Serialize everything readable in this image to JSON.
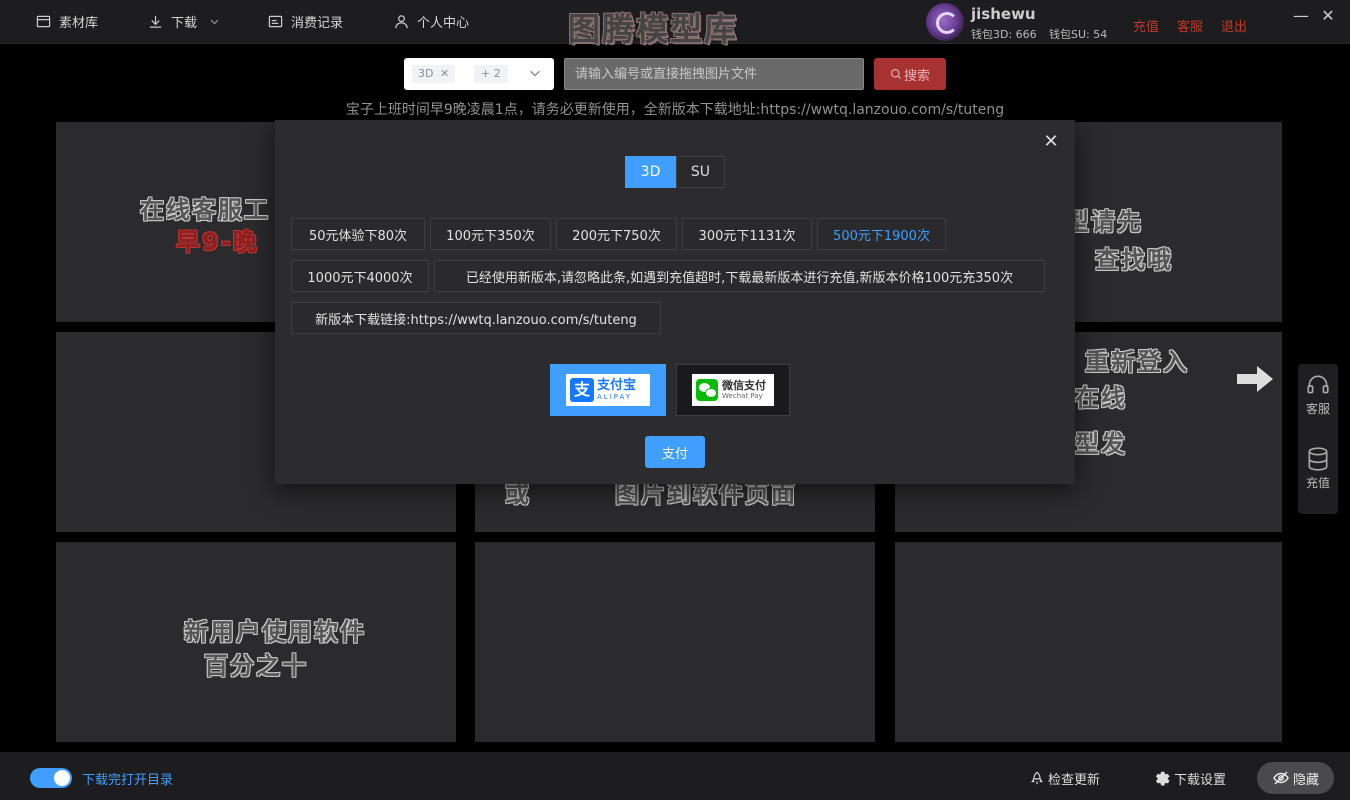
{
  "header": {
    "nav": [
      {
        "label": "素材库",
        "icon": "library-icon"
      },
      {
        "label": "下载",
        "icon": "download-icon"
      },
      {
        "label": "消费记录",
        "icon": "record-icon"
      },
      {
        "label": "个人中心",
        "icon": "user-icon"
      }
    ],
    "app_title": "图腾模型库",
    "username": "jishewu",
    "wallet_3d": "钱包3D: 666",
    "wallet_su": "钱包SU: 54",
    "links": [
      "充值",
      "客服",
      "退出"
    ]
  },
  "search": {
    "tags": [
      "3D",
      "+ 2"
    ],
    "placeholder": "请输入编号或直接拖拽图片文件",
    "button": "搜索"
  },
  "notice": "宝子上班时间早9晚凌晨1点，请务必更新使用，全新版本下载地址:https://wwtq.lanzouo.com/s/tuteng",
  "cards": [
    {
      "lines": [
        "在线客服工",
        "早9-晚"
      ]
    },
    {
      "lines": [
        "型请先",
        "查找哦"
      ]
    },
    {
      "lines": [
        "重新登入",
        "在线",
        "型发"
      ]
    },
    {
      "lines": [
        "或",
        "图片到软件页面"
      ]
    },
    {
      "lines": [
        "新用户使用软件",
        "百分之十"
      ]
    }
  ],
  "modal": {
    "tabs": [
      "3D",
      "SU"
    ],
    "active_tab": "3D",
    "packages": [
      "50元体验下80次",
      "100元下350次",
      "200元下750次",
      "300元下1131次",
      "500元下1900次",
      "1000元下4000次",
      "已经使用新版本,请忽略此条,如遇到充值超时,下载最新版本进行充值,新版本价格100元充350次",
      "新版本下载链接:https://wwtq.lanzouo.com/s/tuteng"
    ],
    "selected_package": "500元下1900次",
    "payment": {
      "alipay": {
        "name": "支付宝",
        "sub": "ALIPAY"
      },
      "wechat": {
        "name": "微信支付",
        "sub": "Wechat Pay"
      }
    },
    "pay_button": "支付"
  },
  "side": [
    "客服",
    "充值"
  ],
  "footer": {
    "toggle_label": "下载完打开目录",
    "check_update": "检查更新",
    "download_settings": "下载设置",
    "hide": "隐藏"
  },
  "colors": {
    "accent": "#409eff",
    "danger": "#c0392b"
  }
}
